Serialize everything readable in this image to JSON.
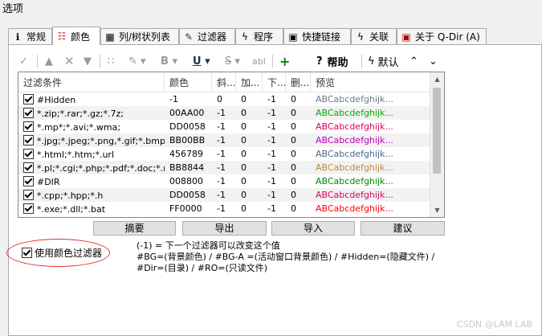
{
  "window": {
    "title": "选项"
  },
  "tabs": [
    {
      "label": "常规",
      "icon": "info-icon"
    },
    {
      "label": "颜色",
      "icon": "palette-icon"
    },
    {
      "label": "列/树状列表",
      "icon": "columns-icon"
    },
    {
      "label": "过滤器",
      "icon": "filter-icon"
    },
    {
      "label": "程序",
      "icon": "lightning-icon"
    },
    {
      "label": "快捷链接",
      "icon": "link-icon"
    },
    {
      "label": "关联",
      "icon": "lightning-icon"
    },
    {
      "label": "关于 Q-Dir (A)",
      "icon": "app-icon"
    }
  ],
  "toolbar": {
    "help_label": "帮助",
    "default_label": "默认",
    "bold_glyph": "B",
    "underline_glyph": "U",
    "strike_glyph": "S",
    "abl_glyph": "abl"
  },
  "grid": {
    "headers": [
      "过滤条件",
      "颜色",
      "斜...",
      "加...",
      "下...",
      "删...",
      "预览"
    ],
    "rows": [
      {
        "filter": "#Hidden",
        "color": "-1",
        "c3": "0",
        "c4": "0",
        "c5": "-1",
        "c6": "0",
        "preview": "ABCabcdefghijk...",
        "pcolor": "#6a7a8a"
      },
      {
        "filter": "*.zip;*.rar;*.gz;*.7z;",
        "color": "00AA00",
        "c3": "-1",
        "c4": "0",
        "c5": "-1",
        "c6": "0",
        "preview": "ABCabcdefghijk...",
        "pcolor": "#00aa00"
      },
      {
        "filter": "*.mp*;*.avi;*.wma;",
        "color": "DD0058",
        "c3": "-1",
        "c4": "0",
        "c5": "-1",
        "c6": "0",
        "preview": "ABCabcdefghijk...",
        "pcolor": "#dd0058"
      },
      {
        "filter": "*.jpg;*.jpeg;*.png,*.gif;*.bmp;*.ico",
        "color": "BB00BB",
        "c3": "-1",
        "c4": "0",
        "c5": "-1",
        "c6": "0",
        "preview": "ABCabcdefghijk...",
        "pcolor": "#bb00bb"
      },
      {
        "filter": "*.html;*.htm;*.url",
        "color": "456789",
        "c3": "-1",
        "c4": "0",
        "c5": "-1",
        "c6": "0",
        "preview": "ABCabcdefghijk...",
        "pcolor": "#456789"
      },
      {
        "filter": "*.pl;*.cgi;*.php;*.pdf;*.doc;*.rtf;*...",
        "color": "BB8844",
        "c3": "-1",
        "c4": "0",
        "c5": "-1",
        "c6": "0",
        "preview": "ABCabcdefghijk...",
        "pcolor": "#bb8844"
      },
      {
        "filter": "#DIR",
        "color": "008800",
        "c3": "-1",
        "c4": "0",
        "c5": "-1",
        "c6": "0",
        "preview": "ABCabcdefghijk...",
        "pcolor": "#008800"
      },
      {
        "filter": "*.cpp;*.hpp;*.h",
        "color": "DD0058",
        "c3": "-1",
        "c4": "0",
        "c5": "-1",
        "c6": "0",
        "preview": "ABCabcdefghijk...",
        "pcolor": "#dd0058"
      },
      {
        "filter": "*.exe;*.dll;*.bat",
        "color": "FF0000",
        "c3": "-1",
        "c4": "0",
        "c5": "-1",
        "c6": "0",
        "preview": "ABCabcdefghijk...",
        "pcolor": "#ff0000"
      }
    ]
  },
  "buttons": {
    "summary": "摘要",
    "export": "导出",
    "import": "导入",
    "suggest": "建议"
  },
  "use_filter_label": "使用颜色过滤器",
  "info": {
    "line1": "(-1) = 下一个过滤器可以改变这个值",
    "line2": "#BG=(背景颜色) / #BG-A =(活动窗口背景颜色) / #Hidden=(隐藏文件) / #Dir=(目录) / #RO=(只读文件)"
  },
  "watermark": "CSDN @LAM LAB"
}
